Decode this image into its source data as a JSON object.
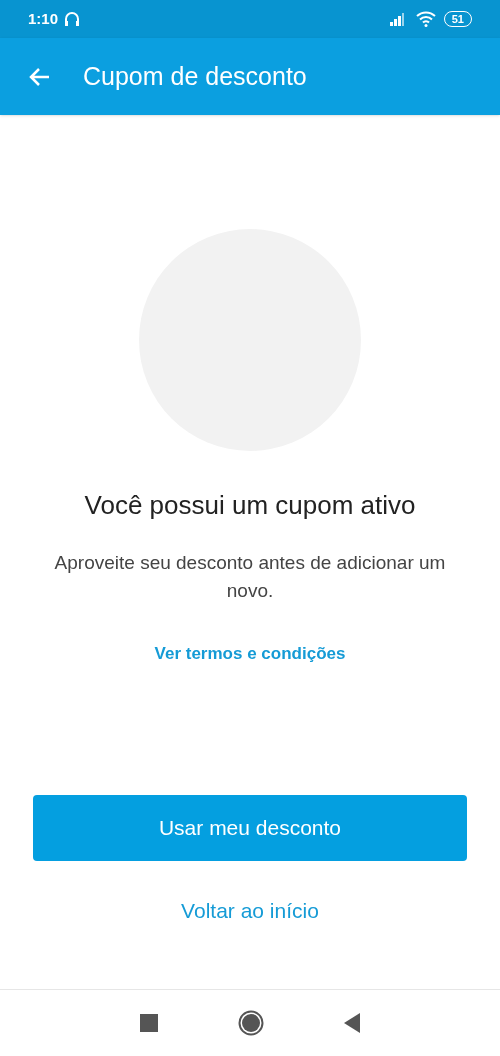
{
  "status_bar": {
    "time": "1:10",
    "battery": "51"
  },
  "app_bar": {
    "title": "Cupom de desconto"
  },
  "content": {
    "title": "Você possui um cupom ativo",
    "message": "Aproveite seu desconto antes de adicionar um novo.",
    "terms_link": "Ver termos e condições"
  },
  "primary_button": "Usar meu desconto",
  "secondary_link": "Voltar ao início"
}
